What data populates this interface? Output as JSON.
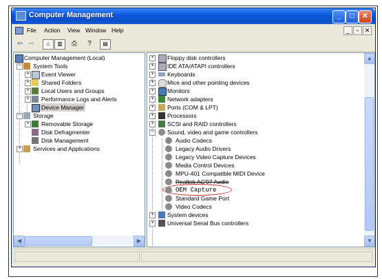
{
  "window": {
    "title": "Computer Management"
  },
  "menu": [
    "File",
    "Action",
    "View",
    "Window",
    "Help"
  ],
  "left_tree": [
    "Computer Management (Local)",
    "System Tools",
    "Event Viewer",
    "Shared Folders",
    "Local Users and Groups",
    "Performance Logs and Alerts",
    "Device Manager",
    "Storage",
    "Removable Storage",
    "Disk Defragmenter",
    "Disk Management",
    "Services and Applications"
  ],
  "right_tree": [
    "Floppy disk controllers",
    "IDE ATA/ATAPI controllers",
    "Keyboards",
    "Mice and other pointing devices",
    "Monitors",
    "Network adapters",
    "Ports (COM & LPT)",
    "Processors",
    "SCSI and RAID controllers",
    "Sound, video and game controllers",
    "Audio Codecs",
    "Legacy Audio Drivers",
    "Legacy Video Capture Devices",
    "Media Control Devices",
    "MPU-401 Compatible MIDI Device",
    "Realtek AC'97 Audio",
    "OEM Capture",
    "Standard Game Port",
    "Video Codecs",
    "System devices",
    "Universal Serial Bus controllers"
  ],
  "colors": {
    "title_bar": "#0a4ec8",
    "selection": "#d6d3ce",
    "highlight_circle": "#d03030"
  }
}
